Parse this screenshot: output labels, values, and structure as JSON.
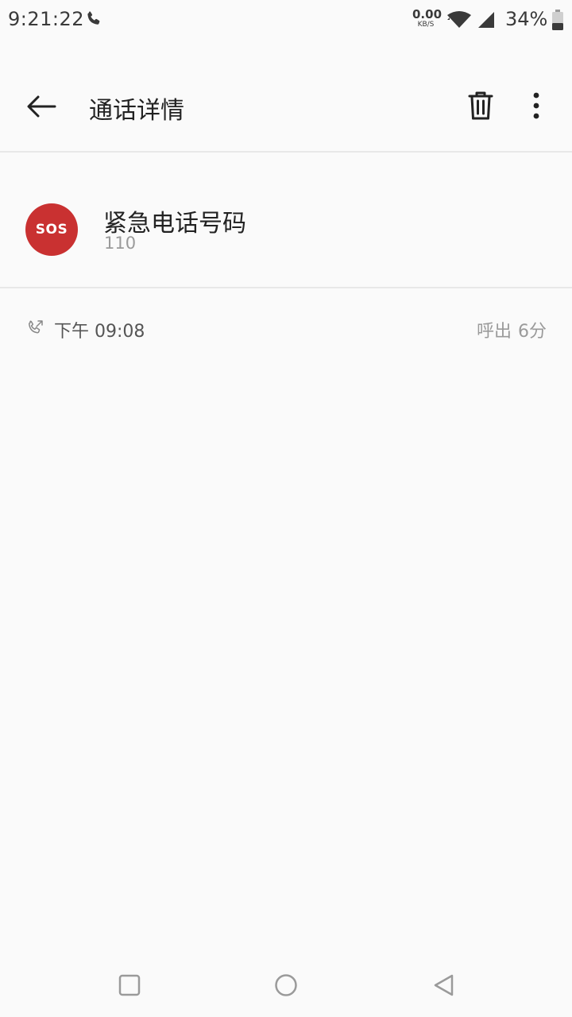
{
  "status_bar": {
    "time": "9:21:22",
    "net_speed_value": "0.00",
    "net_speed_unit": "KB/S",
    "battery_percent": "34%",
    "icons": [
      "phone-call-icon",
      "wifi-icon",
      "cell-signal-icon",
      "battery-icon"
    ]
  },
  "app_bar": {
    "title": "通话详情",
    "icons": [
      "back-arrow-icon",
      "trash-icon",
      "more-vertical-icon"
    ]
  },
  "contact": {
    "avatar_text": "SOS",
    "name": "紧急电话号码",
    "number": "110",
    "avatar_color": "#c93131"
  },
  "call_log": [
    {
      "icon": "outgoing-call-icon",
      "time": "下午 09:08",
      "type": "呼出",
      "duration": "6分"
    }
  ],
  "nav_bar": {
    "icons": [
      "recents-square-icon",
      "home-circle-icon",
      "back-triangle-icon"
    ]
  }
}
